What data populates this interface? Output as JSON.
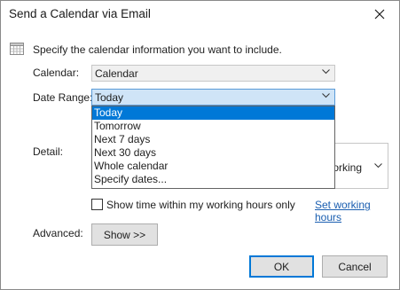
{
  "window": {
    "title": "Send a Calendar via Email"
  },
  "intro": "Specify the calendar information you want to include.",
  "calendar": {
    "label": "Calendar:",
    "value": "Calendar"
  },
  "date_range": {
    "label": "Date Range:",
    "value": "Today",
    "options": [
      "Today",
      "Tomorrow",
      "Next 7 days",
      "Next 30 days",
      "Whole calendar",
      "Specify dates..."
    ],
    "selected_index": 0
  },
  "detail": {
    "label": "Detail:",
    "value_visible": "Working"
  },
  "working_hours": {
    "checkbox_label": "Show time within my working hours only",
    "checked": false,
    "link": "Set working hours"
  },
  "advanced": {
    "label": "Advanced:",
    "show_button": "Show >>"
  },
  "buttons": {
    "ok": "OK",
    "cancel": "Cancel"
  },
  "colors": {
    "selection": "#0078d7",
    "link": "#1a5eb0",
    "active_combo": "#cfe4f7"
  },
  "icons": {
    "close": "close-icon",
    "calendar": "calendar-icon",
    "chevron": "chevron-down-icon"
  }
}
